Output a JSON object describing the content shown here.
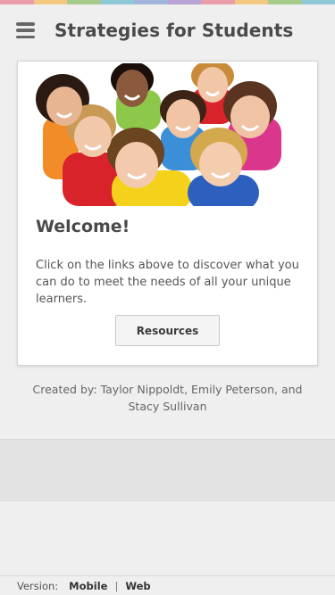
{
  "colors": {
    "rainbow": [
      "#e89da8",
      "#f3c982",
      "#a8cc8c",
      "#8fc9d8",
      "#9fb5dc",
      "#b8a3d4",
      "#e89da8",
      "#f3c982",
      "#a8cc8c",
      "#8fc9d8"
    ],
    "title_text": "#4a4a4a",
    "card_bg": "#ffffff",
    "page_bg": "#efefef"
  },
  "header": {
    "menu_icon": "hamburger-menu-icon",
    "title": "Strategies for Students"
  },
  "card": {
    "photo_description_icon": "group-of-children-photo",
    "heading": "Welcome!",
    "body": "Click on the links above to discover what you can do to meet the needs of all your unique learners.",
    "button_label": "Resources"
  },
  "credits": "Created by: Taylor Nippoldt, Emily Peterson, and Stacy Sullivan",
  "footer": {
    "version_label": "Version:",
    "mobile_label": "Mobile",
    "separator": "|",
    "web_label": "Web"
  }
}
